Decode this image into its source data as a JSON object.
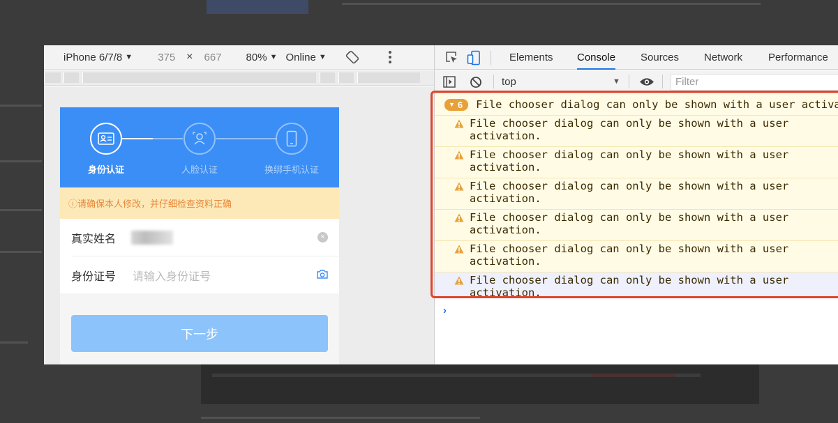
{
  "device_toolbar": {
    "device": "iPhone 6/7/8",
    "width": "375",
    "times": "×",
    "height": "667",
    "zoom": "80%",
    "network": "Online"
  },
  "app": {
    "steps": [
      {
        "label": "身份认证",
        "active": true
      },
      {
        "label": "人脸认证",
        "active": false
      },
      {
        "label": "换绑手机认证",
        "active": false
      }
    ],
    "notice": "ⓘ请确保本人修改，并仔细检查资料正确",
    "fields": {
      "name_label": "真实姓名",
      "id_label": "身份证号",
      "id_placeholder": "请输入身份证号"
    },
    "next_button": "下一步"
  },
  "devtools": {
    "tabs": [
      "Elements",
      "Console",
      "Sources",
      "Network",
      "Performance"
    ],
    "active_tab": "Console",
    "context": "top",
    "filter_placeholder": "Filter",
    "group": {
      "count": "6",
      "message": "File chooser dialog can only be shown with a user activation."
    },
    "warnings": [
      {
        "line1": "File chooser dialog can only be shown with a user",
        "line2": "activation."
      },
      {
        "line1": "File chooser dialog can only be shown with a user",
        "line2": "activation."
      },
      {
        "line1": "File chooser dialog can only be shown with a user",
        "line2": "activation."
      },
      {
        "line1": "File chooser dialog can only be shown with a user",
        "line2": "activation."
      },
      {
        "line1": "File chooser dialog can only be shown with a user",
        "line2": "activation."
      },
      {
        "line1": "File chooser dialog can only be shown with a user",
        "line2": "activation."
      }
    ],
    "prompt_symbol": "›"
  },
  "colors": {
    "app_blue": "#3a8ef6",
    "button_disabled": "#8dc3fb",
    "notice_bg": "#fde9b8",
    "warning_badge": "#e8a13a",
    "highlight_border": "#e0452b",
    "active_tab_underline": "#1a73e8"
  }
}
